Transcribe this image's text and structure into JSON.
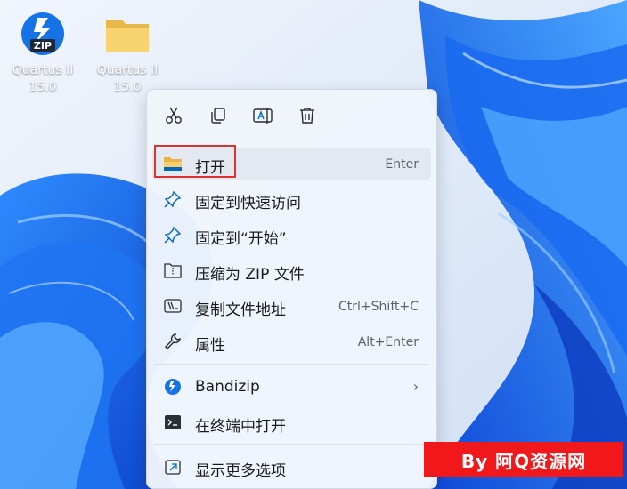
{
  "desktop": {
    "icons": [
      {
        "label_line1": "Quartus II",
        "label_line2": "15.0",
        "icon": "bandizip-zip-icon",
        "badge": "ZIP"
      },
      {
        "label_line1": "Quartus II",
        "label_line2": "15.0",
        "icon": "folder-icon"
      }
    ]
  },
  "context_menu": {
    "quick_actions": [
      "cut-icon",
      "copy-icon",
      "rename-icon",
      "delete-icon"
    ],
    "items": [
      {
        "label": "打开",
        "shortcut": "Enter",
        "icon": "folder-icon",
        "highlighted": true
      },
      {
        "label": "固定到快速访问",
        "shortcut": "",
        "icon": "pin-icon"
      },
      {
        "label": "固定到“开始”",
        "shortcut": "",
        "icon": "pin-icon"
      },
      {
        "label": "压缩为 ZIP 文件",
        "shortcut": "",
        "icon": "zip-folder-icon"
      },
      {
        "label": "复制文件地址",
        "shortcut": "Ctrl+Shift+C",
        "icon": "copy-path-icon"
      },
      {
        "label": "属性",
        "shortcut": "Alt+Enter",
        "icon": "wrench-icon"
      },
      {
        "label": "Bandizip",
        "submenu": "›",
        "icon": "bandizip-icon"
      },
      {
        "label": "在终端中打开",
        "shortcut": "",
        "icon": "terminal-icon"
      },
      {
        "label": "显示更多选项",
        "shortcut": "",
        "icon": "more-options-icon"
      }
    ]
  },
  "watermark": {
    "text": "By 阿Q资源网"
  },
  "colors": {
    "accent": "#0067c0",
    "wallpaper": "#1466e6",
    "highlight_box": "#e0312f",
    "watermark_bg": "#f0181a"
  }
}
